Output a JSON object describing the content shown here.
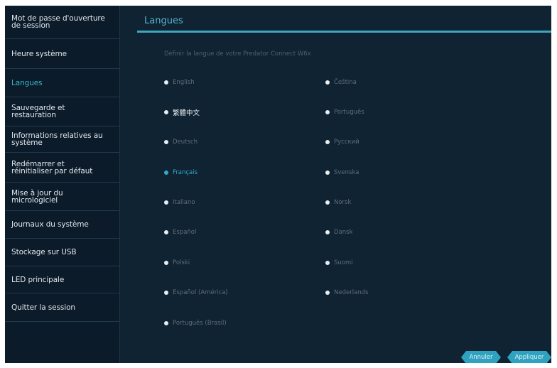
{
  "sidebar": {
    "items": [
      {
        "label": "Mot de passe d'ouverture\nde session",
        "active": false
      },
      {
        "label": "Heure système",
        "active": false
      },
      {
        "label": "Langues",
        "active": true
      },
      {
        "label": "Sauvegarde et\nrestauration",
        "active": false
      },
      {
        "label": "Informations relatives au\nsystème",
        "active": false
      },
      {
        "label": "Redémarrer et\nréinitialiser par défaut",
        "active": false
      },
      {
        "label": "Mise à jour du\nmicrologiciel",
        "active": false
      },
      {
        "label": "Journaux du système",
        "active": false
      },
      {
        "label": "Stockage sur USB",
        "active": false
      },
      {
        "label": "LED principale",
        "active": false
      },
      {
        "label": "Quitter la session",
        "active": false
      }
    ]
  },
  "main": {
    "title": "Langues",
    "subtitle": "Définir la langue de votre Predator Connect W6x",
    "languages_left": [
      "English",
      "繁體中文",
      "Deutsch",
      "Français",
      "Italiano",
      "Español",
      "Polski",
      "Español (América)",
      "Português (Brasil)"
    ],
    "languages_right": [
      "Čeština",
      "Português",
      "Русский",
      "Svenska",
      "Norsk",
      "Dansk",
      "Suomi",
      "Nederlands"
    ],
    "selected_language": "Français",
    "buttons": {
      "cancel": "Annuler",
      "apply": "Appliquer"
    }
  },
  "colors": {
    "accent": "#35b6cf",
    "sidebar_bg": "#0c1b29",
    "panel_bg": "#0f2333"
  }
}
